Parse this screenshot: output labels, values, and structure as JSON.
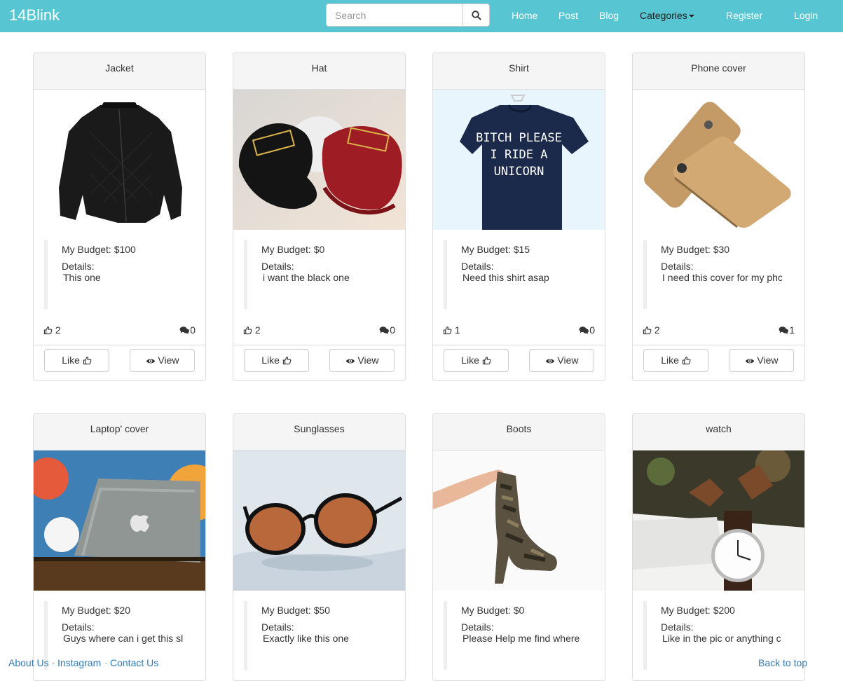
{
  "navbar": {
    "brand": "14Blink",
    "search_placeholder": "Search",
    "links": {
      "home": "Home",
      "post": "Post",
      "blog": "Blog",
      "categories": "Categories",
      "register": "Register",
      "login": "Login"
    }
  },
  "cards": [
    {
      "title": "Jacket",
      "budget": "My Budget: $100",
      "details_label": "Details:",
      "details": "This one",
      "likes": "2",
      "comments": "0",
      "like_label": "Like",
      "view_label": "View"
    },
    {
      "title": "Hat",
      "budget": "My Budget: $0",
      "details_label": "Details:",
      "details": "i want the black one",
      "likes": "2",
      "comments": "0",
      "like_label": "Like",
      "view_label": "View"
    },
    {
      "title": "Shirt",
      "budget": "My Budget: $15",
      "details_label": "Details:",
      "details": "Need this shirt asap",
      "likes": "1",
      "comments": "0",
      "like_label": "Like",
      "view_label": "View",
      "shirt_text": [
        "BITCH PLEASE",
        "I RIDE A",
        "UNICORN"
      ]
    },
    {
      "title": "Phone cover",
      "budget": "My Budget: $30",
      "details_label": "Details:",
      "details": "I need this cover for my phc",
      "likes": "2",
      "comments": "1",
      "like_label": "Like",
      "view_label": "View"
    },
    {
      "title": "Laptop' cover",
      "budget": "My Budget: $20",
      "details_label": "Details:",
      "details": "Guys where can i get this sl"
    },
    {
      "title": "Sunglasses",
      "budget": "My Budget: $50",
      "details_label": "Details:",
      "details": "Exactly like this one"
    },
    {
      "title": "Boots",
      "budget": "My Budget: $0",
      "details_label": "Details:",
      "details": "Please Help me find where"
    },
    {
      "title": "watch",
      "budget": "My Budget: $200",
      "details_label": "Details:",
      "details": "Like in the pic or anything c"
    }
  ],
  "footer": {
    "about": "About Us",
    "instagram": "Instagram",
    "contact": "Contact Us",
    "separator": "·",
    "back_to_top": "Back to top"
  },
  "colors": {
    "navbar": "#57c6d2",
    "link": "#337ab7"
  }
}
